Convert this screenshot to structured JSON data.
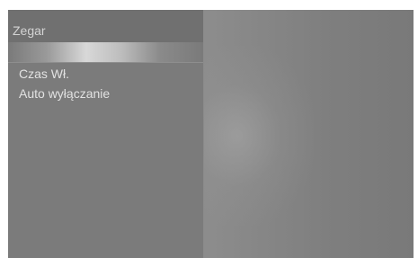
{
  "menu": {
    "title": "Zegar",
    "items": [
      {
        "label": "Czas Wł."
      },
      {
        "label": "Auto wyłączanie"
      }
    ]
  }
}
